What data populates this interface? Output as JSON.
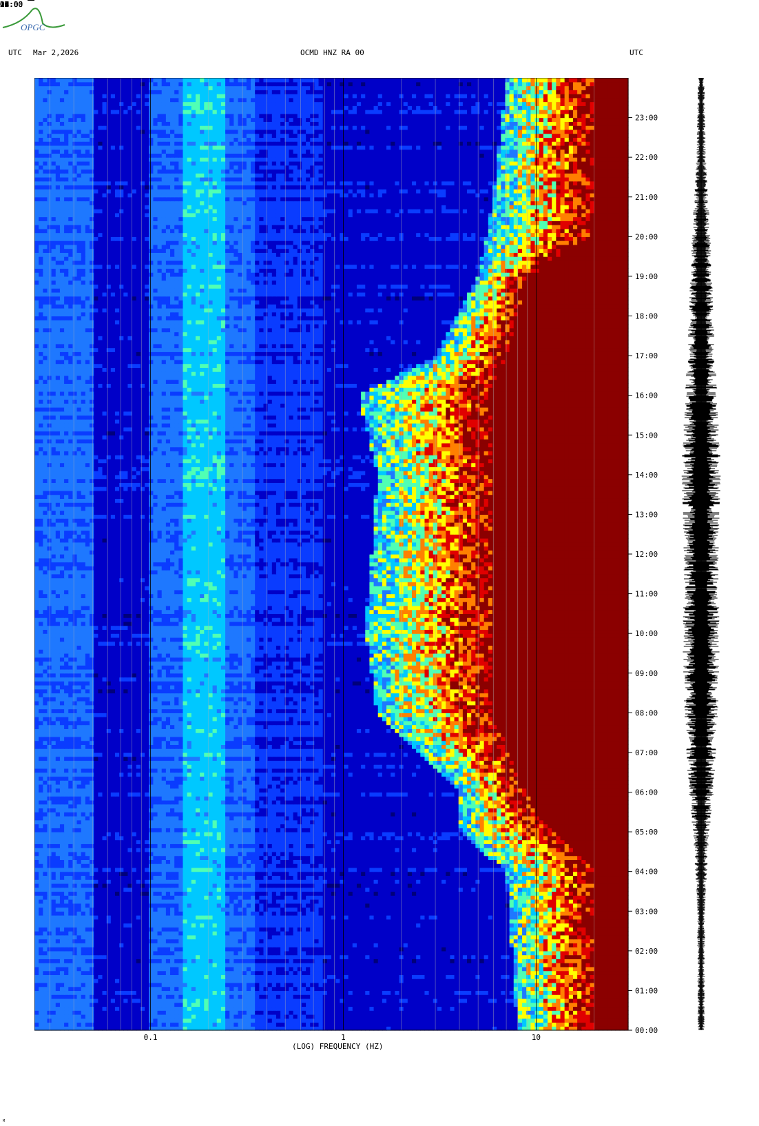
{
  "header": {
    "left_label": "UTC",
    "date": "Mar 2,2026",
    "station": "OCMD HNZ RA 00",
    "right_label": "UTC"
  },
  "logo": {
    "text": "OPGC"
  },
  "corner_mark": "M",
  "chart_data": {
    "type": "heatmap",
    "title": "OCMD HNZ RA 00",
    "xlabel": "(LOG) FREQUENCY (HZ)",
    "x_scale": "log",
    "xlim": [
      0.025,
      30
    ],
    "x_ticks": [
      {
        "value": 0.1,
        "label": "0.1"
      },
      {
        "value": 1,
        "label": "1"
      },
      {
        "value": 10,
        "label": "10"
      }
    ],
    "ylim_hours": [
      0,
      24
    ],
    "y_ticks": [
      "00:00",
      "01:00",
      "02:00",
      "03:00",
      "04:00",
      "05:00",
      "06:00",
      "07:00",
      "08:00",
      "09:00",
      "10:00",
      "11:00",
      "12:00",
      "13:00",
      "14:00",
      "15:00",
      "16:00",
      "17:00",
      "18:00",
      "19:00",
      "20:00",
      "21:00",
      "22:00",
      "23:00"
    ],
    "vertical_grid_hz": [
      0.03,
      0.04,
      0.05,
      0.06,
      0.07,
      0.08,
      0.09,
      0.2,
      0.3,
      0.4,
      0.5,
      0.6,
      0.7,
      0.8,
      0.9,
      2,
      3,
      4,
      5,
      6,
      7,
      8,
      9,
      20
    ],
    "colorscale": [
      "#00007a",
      "#0000c8",
      "#0a3cff",
      "#1e78ff",
      "#00c8ff",
      "#50ffb4",
      "#ffff00",
      "#ff8000",
      "#e00000",
      "#8b0000"
    ],
    "high_noise_onset": [
      {
        "hour": 0,
        "freq_hz": 8
      },
      {
        "hour": 4,
        "freq_hz": 7
      },
      {
        "hour": 5,
        "freq_hz": 4
      },
      {
        "hour": 6,
        "freq_hz": 4
      },
      {
        "hour": 8,
        "freq_hz": 1.5
      },
      {
        "hour": 10,
        "freq_hz": 1.3
      },
      {
        "hour": 12,
        "freq_hz": 1.4
      },
      {
        "hour": 14,
        "freq_hz": 1.5
      },
      {
        "hour": 16,
        "freq_hz": 1.2
      },
      {
        "hour": 17,
        "freq_hz": 3
      },
      {
        "hour": 19,
        "freq_hz": 5
      },
      {
        "hour": 21,
        "freq_hz": 6
      },
      {
        "hour": 24,
        "freq_hz": 7
      }
    ],
    "saturation_onset": [
      {
        "hour": 0,
        "freq_hz": 20
      },
      {
        "hour": 4,
        "freq_hz": 20
      },
      {
        "hour": 5.5,
        "freq_hz": 10
      },
      {
        "hour": 6.5,
        "freq_hz": 8
      },
      {
        "hour": 8,
        "freq_hz": 6
      },
      {
        "hour": 12,
        "freq_hz": 6
      },
      {
        "hour": 16,
        "freq_hz": 6
      },
      {
        "hour": 17,
        "freq_hz": 7
      },
      {
        "hour": 19,
        "freq_hz": 9
      },
      {
        "hour": 20,
        "freq_hz": 20
      },
      {
        "hour": 24,
        "freq_hz": 20
      }
    ],
    "microseism_band_hz": [
      0.15,
      0.25
    ],
    "trace_envelope": [
      {
        "hour": 0,
        "amp": 0.15
      },
      {
        "hour": 3,
        "amp": 0.18
      },
      {
        "hour": 5,
        "amp": 0.35
      },
      {
        "hour": 6,
        "amp": 0.55
      },
      {
        "hour": 8,
        "amp": 0.75
      },
      {
        "hour": 10,
        "amp": 0.8
      },
      {
        "hour": 12,
        "amp": 0.75
      },
      {
        "hour": 14,
        "amp": 0.85
      },
      {
        "hour": 16,
        "amp": 0.7
      },
      {
        "hour": 18,
        "amp": 0.55
      },
      {
        "hour": 20,
        "amp": 0.4
      },
      {
        "hour": 22,
        "amp": 0.2
      },
      {
        "hour": 24,
        "amp": 0.15
      }
    ]
  }
}
